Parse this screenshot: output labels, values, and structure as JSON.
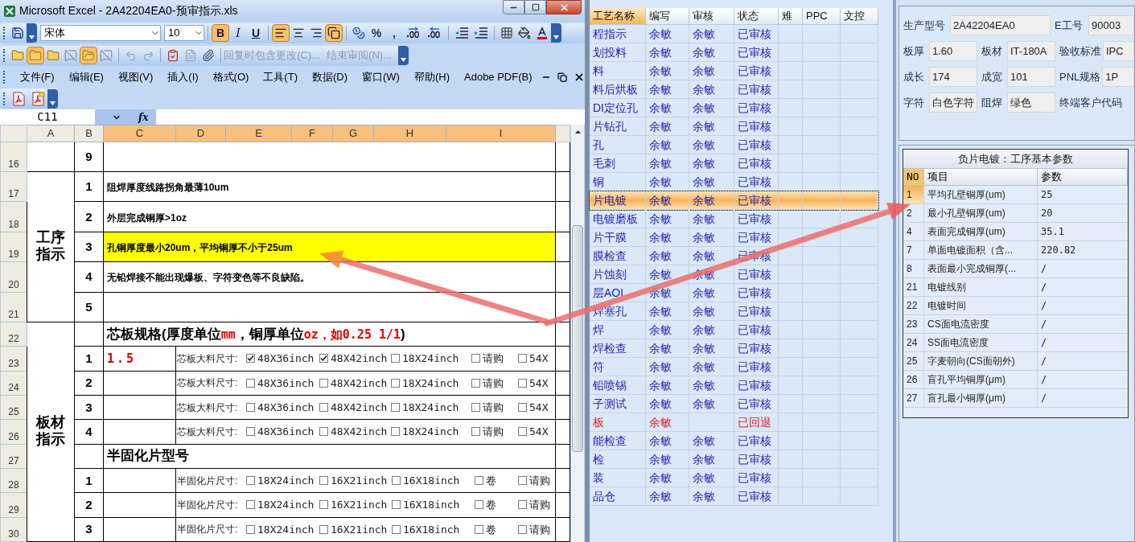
{
  "excel": {
    "title": "Microsoft Excel - 2A42204EA0-预审指示.xls",
    "font_name": "宋体",
    "font_size": "10",
    "format_buttons": [
      {
        "kind": "bold",
        "label": "B",
        "on": true
      },
      {
        "kind": "italic",
        "label": "I",
        "on": false
      },
      {
        "kind": "underline",
        "label": "U",
        "on": false
      },
      {
        "kind": "align-left",
        "on": true
      },
      {
        "kind": "align-center",
        "on": false
      },
      {
        "kind": "align-right",
        "on": false
      },
      {
        "kind": "merge",
        "on": true
      }
    ],
    "number_buttons": [
      "%",
      ","
    ],
    "review_buttons": [
      {
        "kind": "note",
        "on": false
      },
      {
        "kind": "note",
        "on": true
      },
      {
        "kind": "note",
        "on": false
      },
      {
        "kind": "note-off",
        "on": false
      },
      {
        "kind": "notes",
        "on": true
      },
      {
        "kind": "note-off",
        "on": false
      }
    ],
    "review_links": [
      {
        "label": "回复时包含更改(C)...",
        "disabled": true
      },
      {
        "label": "结束审阅(N)...",
        "disabled": true
      }
    ],
    "menu": [
      "文件(F)",
      "编辑(E)",
      "视图(V)",
      "插入(I)",
      "格式(O)",
      "工具(T)",
      "数据(D)",
      "窗口(W)",
      "帮助(H)",
      "Adobe PDF(B)"
    ],
    "name_box": "C11",
    "formula_label": "fx",
    "columns": [
      {
        "label": "A",
        "selected": false
      },
      {
        "label": "B",
        "selected": false
      },
      {
        "label": "C",
        "selected": true
      },
      {
        "label": "D",
        "selected": true
      },
      {
        "label": "E",
        "selected": true
      },
      {
        "label": "F",
        "selected": true
      },
      {
        "label": "G",
        "selected": true
      },
      {
        "label": "H",
        "selected": true
      },
      {
        "label": "I",
        "selected": true
      }
    ],
    "blocks": [
      {
        "rows": [
          {
            "header": "16",
            "no": "9",
            "kind": "note",
            "highlighted": false
          }
        ]
      },
      {
        "title": "工序指示",
        "rows": [
          {
            "header": "17",
            "no": "1",
            "kind": "note",
            "text": "阻焊厚度线路拐角最薄10um",
            "highlighted": false
          },
          {
            "header": "18",
            "no": "2",
            "kind": "note",
            "text": "外层完成铜厚>1oz",
            "highlighted": false
          },
          {
            "header": "19",
            "no": "3",
            "kind": "note",
            "text": "孔铜厚度最小20um，平均铜厚不小于25um",
            "highlighted": true
          },
          {
            "header": "20",
            "no": "4",
            "kind": "note",
            "text": "无铅焊接不能出现爆板、字符变色等不良缺陷。",
            "highlighted": false
          },
          {
            "header": "21",
            "no": "5",
            "kind": "note",
            "highlighted": false
          }
        ]
      },
      {
        "title": "板材指示",
        "rows": [
          {
            "header": "22",
            "kind": "heading",
            "parts": [
              {
                "text": "芯板规格(厚度单位",
                "emphasis": false
              },
              {
                "text": "mm",
                "emphasis": true
              },
              {
                "text": "，铜厚单位",
                "emphasis": false
              },
              {
                "text": "oz，如0.25 1/1",
                "emphasis": true
              },
              {
                "text": ")",
                "emphasis": false
              }
            ]
          },
          {
            "header": "23",
            "no": "1",
            "kind": "core",
            "value": "1.5",
            "label": "芯板大料尺寸:",
            "options": [
              {
                "text": "48X36inch",
                "checked": true
              },
              {
                "text": "48X42inch",
                "checked": true
              },
              {
                "text": "18X24inch",
                "checked": false
              },
              {
                "text": "请购",
                "checked": false
              },
              {
                "text": "54X",
                "checked": false
              }
            ]
          },
          {
            "header": "24",
            "no": "2",
            "kind": "core",
            "label": "芯板大料尺寸:",
            "options": [
              {
                "text": "48X36inch",
                "checked": false
              },
              {
                "text": "48X42inch",
                "checked": false
              },
              {
                "text": "18X24inch",
                "checked": false
              },
              {
                "text": "请购",
                "checked": false
              },
              {
                "text": "54X",
                "checked": false
              }
            ]
          },
          {
            "header": "25",
            "no": "3",
            "kind": "core",
            "label": "芯板大料尺寸:",
            "options": [
              {
                "text": "48X36inch",
                "checked": false
              },
              {
                "text": "48X42inch",
                "checked": false
              },
              {
                "text": "18X24inch",
                "checked": false
              },
              {
                "text": "请购",
                "checked": false
              },
              {
                "text": "54X",
                "checked": false
              }
            ]
          },
          {
            "header": "26",
            "no": "4",
            "kind": "core",
            "label": "芯板大料尺寸:",
            "options": [
              {
                "text": "48X36inch",
                "checked": false
              },
              {
                "text": "48X42inch",
                "checked": false
              },
              {
                "text": "18X24inch",
                "checked": false
              },
              {
                "text": "请购",
                "checked": false
              },
              {
                "text": "54X",
                "checked": false
              }
            ]
          },
          {
            "header": "27",
            "kind": "heading",
            "parts": [
              {
                "text": "半固化片型号",
                "emphasis": false
              }
            ]
          },
          {
            "header": "28",
            "no": "1",
            "kind": "prepreg",
            "label": "半固化片尺寸:",
            "options": [
              {
                "text": "18X24inch",
                "checked": false
              },
              {
                "text": "16X21inch",
                "checked": false
              },
              {
                "text": "16X18inch",
                "checked": false
              },
              {
                "text": "卷",
                "checked": false
              },
              {
                "text": "请购",
                "checked": false
              }
            ]
          },
          {
            "header": "29",
            "no": "2",
            "kind": "prepreg",
            "label": "半固化片尺寸:",
            "options": [
              {
                "text": "18X24inch",
                "checked": false
              },
              {
                "text": "16X21inch",
                "checked": false
              },
              {
                "text": "16X18inch",
                "checked": false
              },
              {
                "text": "卷",
                "checked": false
              },
              {
                "text": "请购",
                "checked": false
              }
            ]
          },
          {
            "header": "30",
            "no": "3",
            "kind": "prepreg",
            "label": "半固化片尺寸:",
            "options": [
              {
                "text": "18X24inch",
                "checked": false
              },
              {
                "text": "16X21inch",
                "checked": false
              },
              {
                "text": "16X18inch",
                "checked": false
              },
              {
                "text": "卷",
                "checked": false
              },
              {
                "text": "请购",
                "checked": false
              }
            ]
          }
        ]
      }
    ]
  },
  "process_list": {
    "columns": [
      "工艺名称",
      "编写",
      "审核",
      "状态",
      "难",
      "PPC",
      "文控"
    ],
    "rows": [
      {
        "name": "程指示",
        "writer": "余敏",
        "reviewer": "余敏",
        "status": "已审核",
        "kind": "approved",
        "selected": false
      },
      {
        "name": "划投料",
        "writer": "余敏",
        "reviewer": "余敏",
        "status": "已审核",
        "kind": "approved",
        "selected": false
      },
      {
        "name": "料",
        "writer": "余敏",
        "reviewer": "余敏",
        "status": "已审核",
        "kind": "approved",
        "selected": false
      },
      {
        "name": "料后烘板",
        "writer": "余敏",
        "reviewer": "余敏",
        "status": "已审核",
        "kind": "approved",
        "selected": false
      },
      {
        "name": "DI定位孔",
        "writer": "余敏",
        "reviewer": "余敏",
        "status": "已审核",
        "kind": "approved",
        "selected": false
      },
      {
        "name": "片钻孔",
        "writer": "余敏",
        "reviewer": "余敏",
        "status": "已审核",
        "kind": "approved",
        "selected": false
      },
      {
        "name": "孔",
        "writer": "余敏",
        "reviewer": "余敏",
        "status": "已审核",
        "kind": "approved",
        "selected": false
      },
      {
        "name": "毛刺",
        "writer": "余敏",
        "reviewer": "余敏",
        "status": "已审核",
        "kind": "approved",
        "selected": false
      },
      {
        "name": "铜",
        "writer": "余敏",
        "reviewer": "余敏",
        "status": "已审核",
        "kind": "approved",
        "selected": false
      },
      {
        "name": "片电镀",
        "writer": "余敏",
        "reviewer": "余敏",
        "status": "已审核",
        "kind": "approved",
        "selected": true
      },
      {
        "name": "电镀磨板",
        "writer": "余敏",
        "reviewer": "余敏",
        "status": "已审核",
        "kind": "approved",
        "selected": false
      },
      {
        "name": "片干膜",
        "writer": "余敏",
        "reviewer": "余敏",
        "status": "已审核",
        "kind": "approved",
        "selected": false
      },
      {
        "name": "膜检查",
        "writer": "余敏",
        "reviewer": "余敏",
        "status": "已审核",
        "kind": "approved",
        "selected": false
      },
      {
        "name": "片蚀刻",
        "writer": "余敏",
        "reviewer": "余敏",
        "status": "已审核",
        "kind": "approved",
        "selected": false
      },
      {
        "name": "层AOI",
        "writer": "余敏",
        "reviewer": "余敏",
        "status": "已审核",
        "kind": "approved",
        "selected": false
      },
      {
        "name": "焊塞孔",
        "writer": "余敏",
        "reviewer": "余敏",
        "status": "已审核",
        "kind": "approved",
        "selected": false
      },
      {
        "name": "焊",
        "writer": "余敏",
        "reviewer": "余敏",
        "status": "已审核",
        "kind": "approved",
        "selected": false
      },
      {
        "name": "焊检查",
        "writer": "余敏",
        "reviewer": "余敏",
        "status": "已审核",
        "kind": "approved",
        "selected": false
      },
      {
        "name": "符",
        "writer": "余敏",
        "reviewer": "余敏",
        "status": "已审核",
        "kind": "approved",
        "selected": false
      },
      {
        "name": "铅喷锡",
        "writer": "余敏",
        "reviewer": "余敏",
        "status": "已审核",
        "kind": "approved",
        "selected": false
      },
      {
        "name": "子测试",
        "writer": "余敏",
        "reviewer": "余敏",
        "status": "已审核",
        "kind": "approved",
        "selected": false
      },
      {
        "name": "板",
        "writer": "余敏",
        "status": "已回退",
        "kind": "returned",
        "selected": false
      },
      {
        "name": "能检查",
        "writer": "余敏",
        "reviewer": "余敏",
        "status": "已审核",
        "kind": "approved",
        "selected": false
      },
      {
        "name": "检",
        "writer": "余敏",
        "reviewer": "余敏",
        "status": "已审核",
        "kind": "approved",
        "selected": false
      },
      {
        "name": "装",
        "writer": "余敏",
        "reviewer": "余敏",
        "status": "已审核",
        "kind": "approved",
        "selected": false
      },
      {
        "name": "品仓",
        "writer": "余敏",
        "reviewer": "余敏",
        "status": "已审核",
        "kind": "approved",
        "selected": false
      }
    ]
  },
  "info": [
    [
      {
        "label": "生产型号",
        "value": "2A42204EA0"
      },
      {
        "label": "E工号",
        "value": "90003"
      }
    ],
    [
      {
        "label": "板厚",
        "value": "1.60"
      },
      {
        "label": "板材",
        "value": "IT-180A"
      },
      {
        "label": "验收标准",
        "value": "IPC"
      }
    ],
    [
      {
        "label": "成长",
        "value": "174"
      },
      {
        "label": "成宽",
        "value": "101"
      },
      {
        "label": "PNL规格",
        "value": "1P"
      }
    ],
    [
      {
        "label": "字符",
        "value": "白色字符"
      },
      {
        "label": "阻焊",
        "value": "绿色"
      },
      {
        "label": "终端客户代码"
      }
    ]
  ],
  "params": {
    "title": "负片电镀：工序基本参数",
    "columns": [
      "NO",
      "项目",
      "参数"
    ],
    "rows": [
      {
        "no": "1",
        "item": "平均孔壁铜厚(um)",
        "value": "25",
        "selected": true
      },
      {
        "no": "2",
        "item": "最小孔壁铜厚(um)",
        "value": "20",
        "selected": false
      },
      {
        "no": "4",
        "item": "表面完成铜厚(um)",
        "value": "35.1",
        "selected": false
      },
      {
        "no": "7",
        "item": "单面电镀面积（含...",
        "value": "220.82",
        "selected": false
      },
      {
        "no": "8",
        "item": "表面最小完成铜厚(...",
        "value": "/",
        "selected": false
      },
      {
        "no": "21",
        "item": "电镀线别",
        "value": "/",
        "selected": false
      },
      {
        "no": "22",
        "item": "电镀时间",
        "value": "/",
        "selected": false
      },
      {
        "no": "23",
        "item": "CS面电流密度",
        "value": "/",
        "selected": false
      },
      {
        "no": "24",
        "item": "SS面电流密度",
        "value": "/",
        "selected": false
      },
      {
        "no": "25",
        "item": "字麦朝向(CS面朝外)",
        "value": "/",
        "selected": false
      },
      {
        "no": "26",
        "item": "盲孔平均铜厚(μm)",
        "value": "/",
        "selected": false
      },
      {
        "no": "27",
        "item": "盲孔最小铜厚(μm)",
        "value": "/",
        "selected": false
      }
    ]
  }
}
